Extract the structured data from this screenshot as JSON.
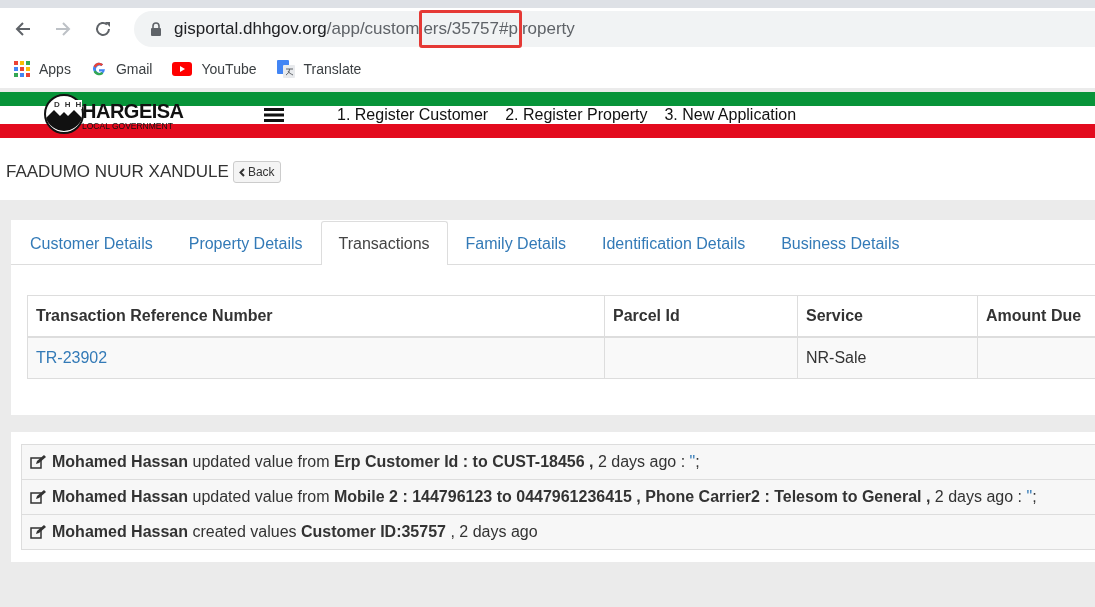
{
  "browser": {
    "url": {
      "host": "gisportal.dhhgov.org",
      "path_before": "/app/custom",
      "highlighted": "ers/35757#p",
      "path_after": "roperty"
    },
    "bookmarks": [
      {
        "label": "Apps",
        "kind": "apps"
      },
      {
        "label": "Gmail",
        "kind": "google"
      },
      {
        "label": "YouTube",
        "kind": "youtube"
      },
      {
        "label": "Translate",
        "kind": "translate"
      }
    ]
  },
  "header": {
    "logo_title": "HARGEISA",
    "logo_subtitle": "LOCAL GOVERNMENT",
    "logo_letters": [
      "D",
      "H",
      "H"
    ],
    "nav": [
      "1. Register Customer",
      "2. Register Property",
      "3. New Application"
    ]
  },
  "customer": {
    "name": "FAADUMO NUUR XANDULE",
    "back_button": "Back"
  },
  "tabs": [
    {
      "label": "Customer Details",
      "selected": false
    },
    {
      "label": "Property Details",
      "selected": false
    },
    {
      "label": "Transactions",
      "selected": true
    },
    {
      "label": "Family Details",
      "selected": false
    },
    {
      "label": "Identification Details",
      "selected": false
    },
    {
      "label": "Business Details",
      "selected": false
    }
  ],
  "table": {
    "columns": [
      "Transaction Reference Number",
      "Parcel Id",
      "Service",
      "Amount Due"
    ],
    "rows": [
      {
        "reference": "TR-23902",
        "service": "NR-Sale"
      }
    ]
  },
  "activity_log": [
    {
      "text": "**Mohamed Hassan** updated value from **Erp Customer Id : to CUST-18456 ,** 2 days ago : ",
      "link": "\"",
      "suffix": ";"
    },
    {
      "text": "**Mohamed Hassan** updated value from **Mobile 2 : 144796123 to 0447961236415 , Phone Carrier2 : Telesom to General ,** 2 days ago : ",
      "link": "\"",
      "suffix": ";"
    },
    {
      "text": "**Mohamed Hassan** created values **Customer ID:35757** , 2 days ago"
    }
  ]
}
